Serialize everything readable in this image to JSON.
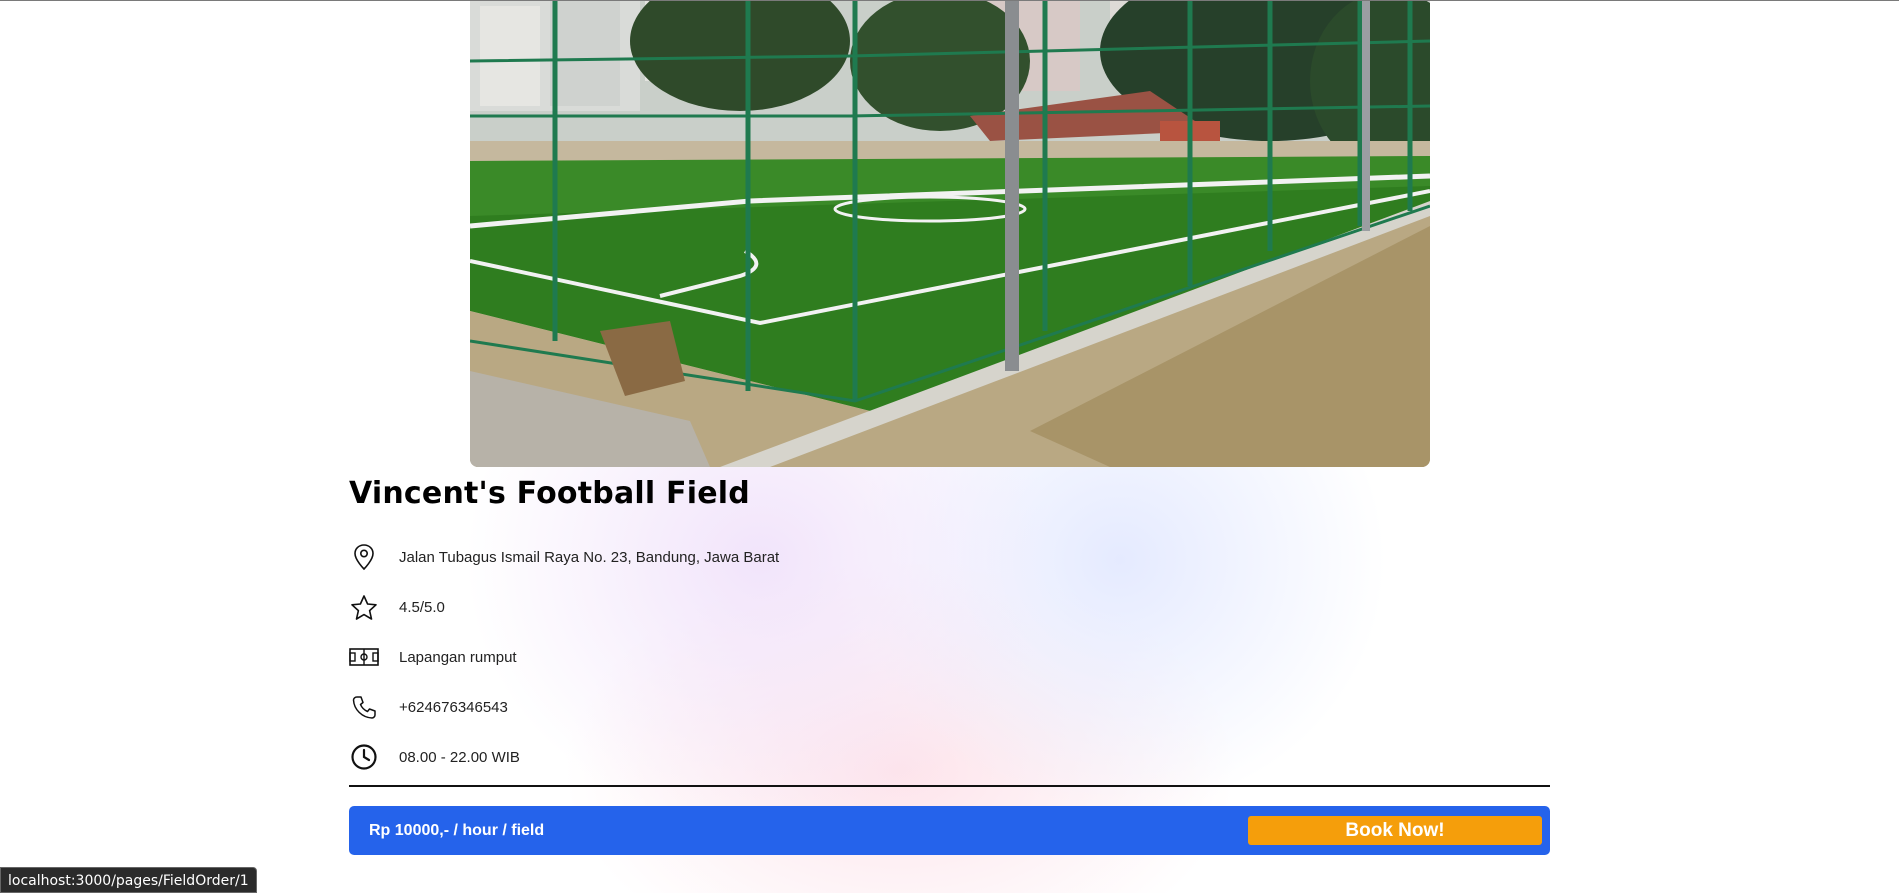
{
  "field": {
    "name": "Vincent's Football Field",
    "image_icon": "football-field-photo"
  },
  "details": {
    "address": "Jalan Tubagus Ismail Raya No. 23, Bandung, Jawa Barat",
    "rating": "4.5/5.0",
    "field_type": "Lapangan rumput",
    "phone": "+624676346543",
    "hours": "08.00 - 22.00 WIB"
  },
  "icons": {
    "address": "map-pin-icon",
    "rating": "star-icon",
    "field_type": "field-icon",
    "phone": "phone-icon",
    "hours": "clock-icon"
  },
  "booking": {
    "price_label": "Rp 10000,- / hour / field",
    "button_label": "Book Now!"
  },
  "status_bar": {
    "url": "localhost:3000/pages/FieldOrder/1"
  },
  "colors": {
    "primary": "#2563eb",
    "accent": "#f59e0b",
    "turf": "#2f7d1f",
    "fence": "#1f7a4f"
  }
}
